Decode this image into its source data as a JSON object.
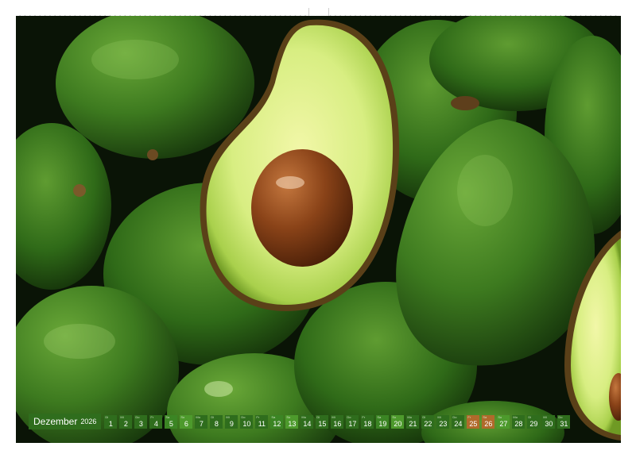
{
  "calendar": {
    "month": "Dezember",
    "year": "2026",
    "days": [
      {
        "n": "1",
        "wd": "Di"
      },
      {
        "n": "2",
        "wd": "Mi"
      },
      {
        "n": "3",
        "wd": "Do"
      },
      {
        "n": "4",
        "wd": "Fr"
      },
      {
        "n": "5",
        "wd": "Sa"
      },
      {
        "n": "6",
        "wd": "So"
      },
      {
        "n": "7",
        "wd": "Mo"
      },
      {
        "n": "8",
        "wd": "Di"
      },
      {
        "n": "9",
        "wd": "Mi"
      },
      {
        "n": "10",
        "wd": "Do"
      },
      {
        "n": "11",
        "wd": "Fr"
      },
      {
        "n": "12",
        "wd": "Sa"
      },
      {
        "n": "13",
        "wd": "So"
      },
      {
        "n": "14",
        "wd": "Mo"
      },
      {
        "n": "15",
        "wd": "Di"
      },
      {
        "n": "16",
        "wd": "Mi"
      },
      {
        "n": "17",
        "wd": "Do"
      },
      {
        "n": "18",
        "wd": "Fr"
      },
      {
        "n": "19",
        "wd": "Sa"
      },
      {
        "n": "20",
        "wd": "So"
      },
      {
        "n": "21",
        "wd": "Mo"
      },
      {
        "n": "22",
        "wd": "Di"
      },
      {
        "n": "23",
        "wd": "Mi"
      },
      {
        "n": "24",
        "wd": "Do"
      },
      {
        "n": "25",
        "wd": "Fr"
      },
      {
        "n": "26",
        "wd": "Sa"
      },
      {
        "n": "27",
        "wd": "So"
      },
      {
        "n": "28",
        "wd": "Mo"
      },
      {
        "n": "29",
        "wd": "Di"
      },
      {
        "n": "30",
        "wd": "Mi"
      },
      {
        "n": "31",
        "wd": "Do"
      }
    ]
  },
  "colors": {
    "calendar_bar": "#2f6d1d",
    "avocado_skin": "#3d7a1f",
    "avocado_flesh": "#dff08a",
    "avocado_seed": "#7a3a14"
  }
}
